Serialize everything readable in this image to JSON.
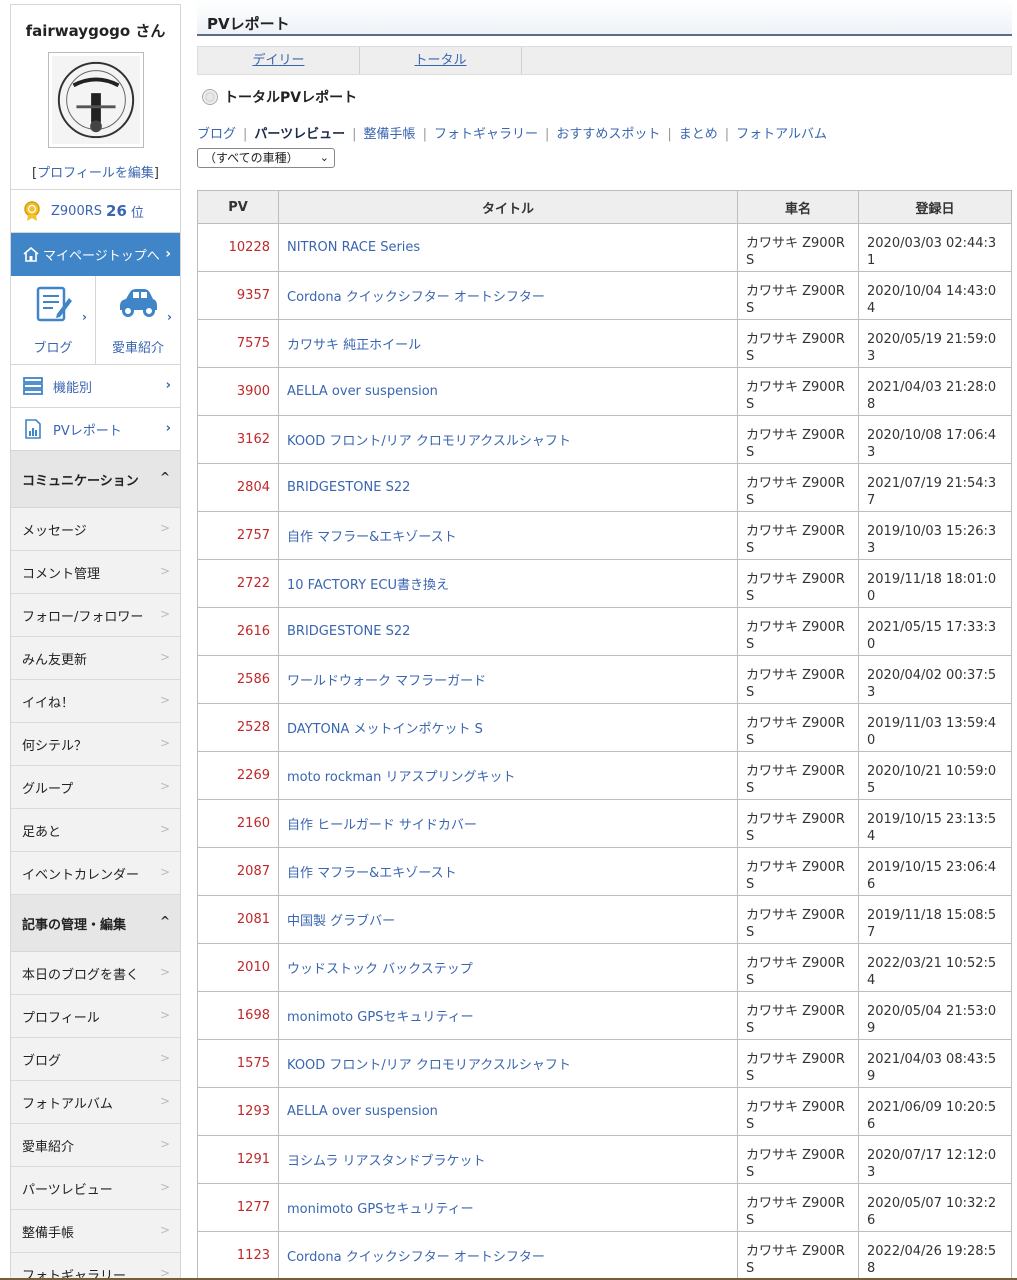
{
  "sidebar": {
    "username": "fairwaygogo さん",
    "edit_profile": {
      "prefix": "[",
      "label": "プロフィールを編集",
      "suffix": "]"
    },
    "rank": {
      "car": "Z900RS",
      "position": "26",
      "unit": "位"
    },
    "mypage_label": "マイページトップへ",
    "blog_label": "ブログ",
    "car_label": "愛車紹介",
    "functions_label": "機能別",
    "pv_report_label": "PVレポート",
    "communication": {
      "title": "コミュニケーション",
      "items": [
        "メッセージ",
        "コメント管理",
        "フォロー/フォロワー",
        "みん友更新",
        "イイね！",
        "何シテル？",
        "グループ",
        "足あと",
        "イベントカレンダー"
      ]
    },
    "articles": {
      "title": "記事の管理・編集",
      "items": [
        "本日のブログを書く",
        "プロフィール",
        "ブログ",
        "フォトアルバム",
        "愛車紹介",
        "パーツレビュー",
        "整備手帳",
        "フォトギャラリー"
      ]
    }
  },
  "main": {
    "page_title": "PVレポート",
    "tabs": [
      "デイリー",
      "トータル"
    ],
    "report_title": "トータルPVレポート",
    "filters": [
      "ブログ",
      "パーツレビュー",
      "整備手帳",
      "フォトギャラリー",
      "おすすめスポット",
      "まとめ",
      "フォトアルバム"
    ],
    "active_filter": "パーツレビュー",
    "car_select": "（すべての車種）",
    "table": {
      "headers": [
        "PV",
        "タイトル",
        "車名",
        "登録日"
      ],
      "rows": [
        {
          "pv": "10228",
          "title": "NITRON RACE Series",
          "car": "カワサキ Z900RS",
          "date": "2020/03/03 02:44:31"
        },
        {
          "pv": "9357",
          "title": "Cordona クイックシフター オートシフター",
          "car": "カワサキ Z900RS",
          "date": "2020/10/04 14:43:04"
        },
        {
          "pv": "7575",
          "title": "カワサキ 純正ホイール",
          "car": "カワサキ Z900RS",
          "date": "2020/05/19 21:59:03"
        },
        {
          "pv": "3900",
          "title": "AELLA over suspension",
          "car": "カワサキ Z900RS",
          "date": "2021/04/03 21:28:08"
        },
        {
          "pv": "3162",
          "title": "KOOD フロント/リア クロモリアクスルシャフト",
          "car": "カワサキ Z900RS",
          "date": "2020/10/08 17:06:43"
        },
        {
          "pv": "2804",
          "title": "BRIDGESTONE S22",
          "car": "カワサキ Z900RS",
          "date": "2021/07/19 21:54:37"
        },
        {
          "pv": "2757",
          "title": "自作 マフラー&エキゾースト",
          "car": "カワサキ Z900RS",
          "date": "2019/10/03 15:26:33"
        },
        {
          "pv": "2722",
          "title": "10 FACTORY ECU書き換え",
          "car": "カワサキ Z900RS",
          "date": "2019/11/18 18:01:00"
        },
        {
          "pv": "2616",
          "title": "BRIDGESTONE S22",
          "car": "カワサキ Z900RS",
          "date": "2021/05/15 17:33:30"
        },
        {
          "pv": "2586",
          "title": "ワールドウォーク マフラーガード",
          "car": "カワサキ Z900RS",
          "date": "2020/04/02 00:37:53"
        },
        {
          "pv": "2528",
          "title": "DAYTONA メットインポケット S",
          "car": "カワサキ Z900RS",
          "date": "2019/11/03 13:59:40"
        },
        {
          "pv": "2269",
          "title": "moto rockman リアスプリングキット",
          "car": "カワサキ Z900RS",
          "date": "2020/10/21 10:59:05"
        },
        {
          "pv": "2160",
          "title": "自作 ヒールガード サイドカバー",
          "car": "カワサキ Z900RS",
          "date": "2019/10/15 23:13:54"
        },
        {
          "pv": "2087",
          "title": "自作 マフラー&エキゾースト",
          "car": "カワサキ Z900RS",
          "date": "2019/10/15 23:06:46"
        },
        {
          "pv": "2081",
          "title": "中国製 グラブバー",
          "car": "カワサキ Z900RS",
          "date": "2019/11/18 15:08:57"
        },
        {
          "pv": "2010",
          "title": "ウッドストック バックステップ",
          "car": "カワサキ Z900RS",
          "date": "2022/03/21 10:52:54"
        },
        {
          "pv": "1698",
          "title": "monimoto GPSセキュリティー",
          "car": "カワサキ Z900RS",
          "date": "2020/05/04 21:53:09"
        },
        {
          "pv": "1575",
          "title": "KOOD フロント/リア クロモリアクスルシャフト",
          "car": "カワサキ Z900RS",
          "date": "2021/04/03 08:43:59"
        },
        {
          "pv": "1293",
          "title": "AELLA over suspension",
          "car": "カワサキ Z900RS",
          "date": "2021/06/09 10:20:56"
        },
        {
          "pv": "1291",
          "title": "ヨシムラ リアスタンドブラケット",
          "car": "カワサキ Z900RS",
          "date": "2020/07/17 12:12:03"
        },
        {
          "pv": "1277",
          "title": "monimoto GPSセキュリティー",
          "car": "カワサキ Z900RS",
          "date": "2020/05/07 10:32:26"
        },
        {
          "pv": "1123",
          "title": "Cordona クイックシフター オートシフター",
          "car": "カワサキ Z900RS",
          "date": "2022/04/26 19:28:58"
        }
      ]
    }
  }
}
